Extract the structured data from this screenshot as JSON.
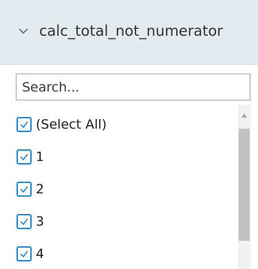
{
  "header": {
    "title": "calc_total_not_numerator",
    "icon": "chevron-down-icon"
  },
  "search": {
    "placeholder": "Search..."
  },
  "items": [
    {
      "label": "(Select All)",
      "checked": true
    },
    {
      "label": "1",
      "checked": true
    },
    {
      "label": "2",
      "checked": true
    },
    {
      "label": "3",
      "checked": true
    },
    {
      "label": "4",
      "checked": true
    }
  ],
  "colors": {
    "header_bg": "#e4ebf0",
    "checkbox_accent": "#1a88d6",
    "scroll_thumb": "#c1c1c1"
  }
}
